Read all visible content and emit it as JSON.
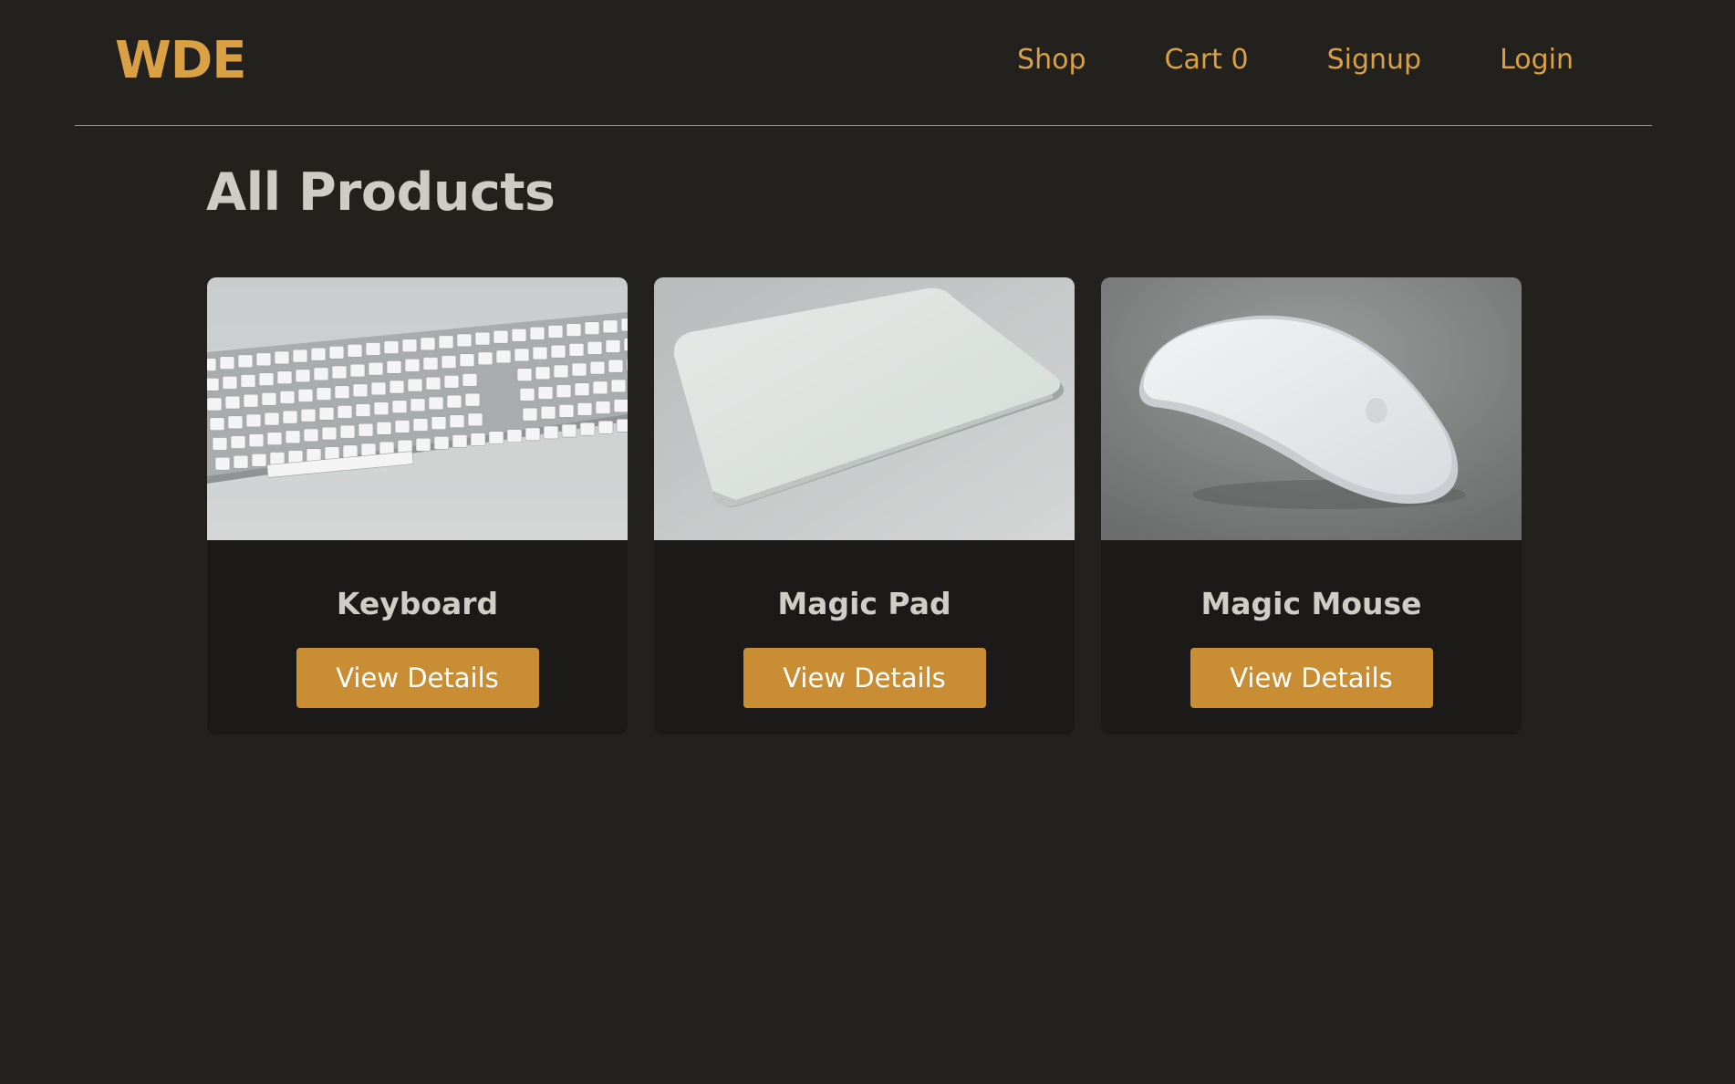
{
  "header": {
    "logo": "WDE",
    "nav": {
      "shop": "Shop",
      "cart": "Cart 0",
      "signup": "Signup",
      "login": "Login"
    }
  },
  "main": {
    "title": "All Products",
    "products": [
      {
        "name": "Keyboard",
        "button_label": "View Details",
        "image": "keyboard-photo"
      },
      {
        "name": "Magic Pad",
        "button_label": "View Details",
        "image": "trackpad-photo"
      },
      {
        "name": "Magic Mouse",
        "button_label": "View Details",
        "image": "mouse-photo"
      }
    ]
  },
  "colors": {
    "background": "#23211e",
    "card": "#1c1a18",
    "accent": "#c98d34",
    "logo": "#d9a044",
    "heading": "#cfcbc6"
  }
}
